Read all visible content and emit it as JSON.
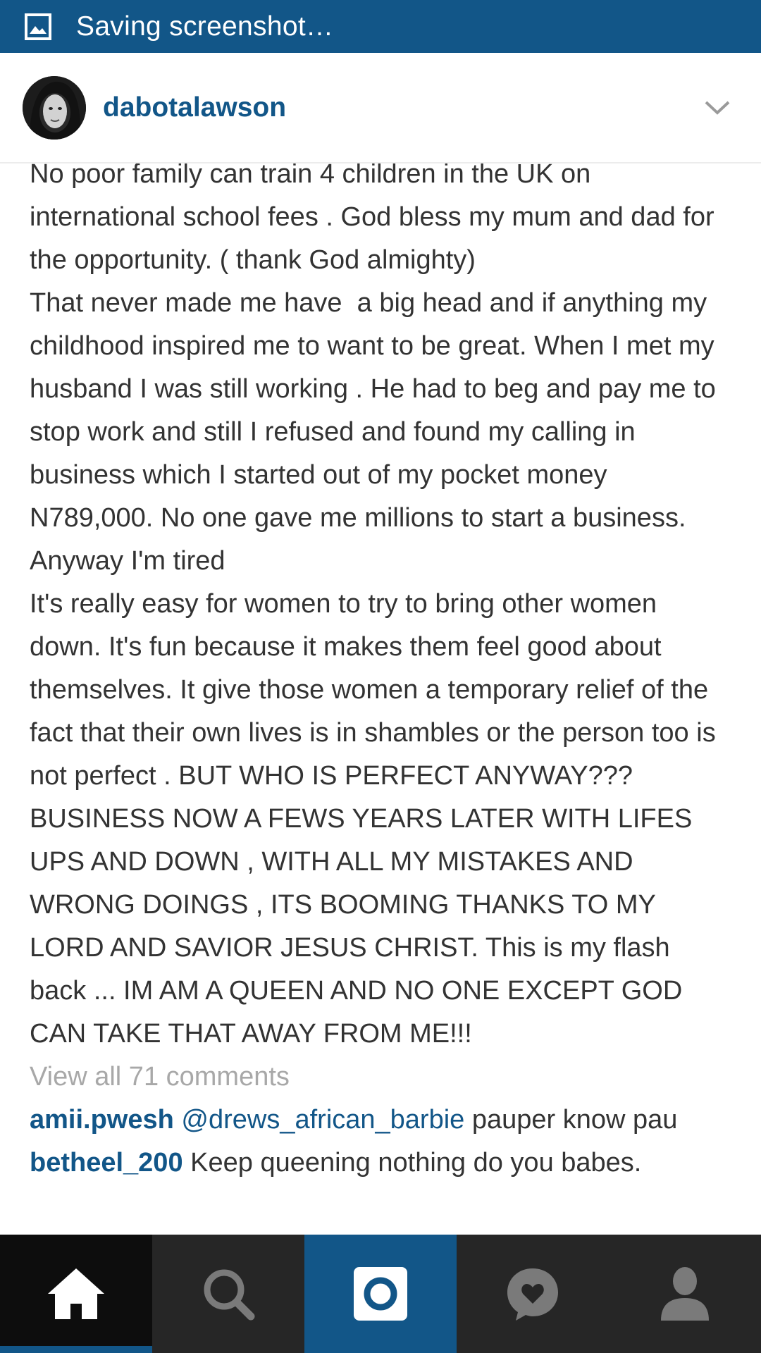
{
  "notification": {
    "text": "Saving screenshot…",
    "icon": "image-icon"
  },
  "post": {
    "username": "dabotalawson",
    "avatar": "avatar",
    "options_icon": "chevron-down-icon",
    "caption": "No poor family can train 4 children in the UK on international school fees . God bless my mum and dad for the opportunity. ( thank God almighty)\nThat never made me have  a big head and if anything my childhood inspired me to want to be great. When I met my husband I was still working . He had to beg and pay me to stop work and still I refused and found my calling in business which I started out of my pocket money  N789,000. No one gave me millions to start a business. Anyway I'm tired\nIt's really easy for women to try to bring other women down. It's fun because it makes them feel good about themselves. It give those women a temporary relief of the fact that their own lives is in shambles or the person too is not perfect . BUT WHO IS PERFECT ANYWAY??? BUSINESS NOW A FEWS YEARS LATER WITH LIFES UPS AND DOWN , WITH ALL MY MISTAKES AND WRONG DOINGS , ITS BOOMING THANKS TO MY LORD AND SAVIOR JESUS CHRIST. This is my flash back ... IM AM A QUEEN AND NO ONE EXCEPT GOD CAN TAKE THAT AWAY FROM ME!!!",
    "view_all_comments": "View all 71 comments",
    "comments": [
      {
        "user": "amii.pwesh",
        "mention": "@drews_african_barbie",
        "text": " pauper know pau"
      },
      {
        "user": "betheel_200",
        "mention": "",
        "text": " Keep queening nothing do you babes."
      }
    ]
  },
  "bottom_nav": {
    "items": [
      {
        "name": "home",
        "icon": "home-icon",
        "active": true
      },
      {
        "name": "search",
        "icon": "search-icon",
        "active": false
      },
      {
        "name": "camera",
        "icon": "camera-icon",
        "active": false
      },
      {
        "name": "activity",
        "icon": "heart-bubble-icon",
        "active": false
      },
      {
        "name": "profile",
        "icon": "person-icon",
        "active": false
      }
    ]
  },
  "colors": {
    "brand_blue": "#125688",
    "nav_dark": "#262626",
    "text": "#333333",
    "muted": "#a8a8a8"
  }
}
